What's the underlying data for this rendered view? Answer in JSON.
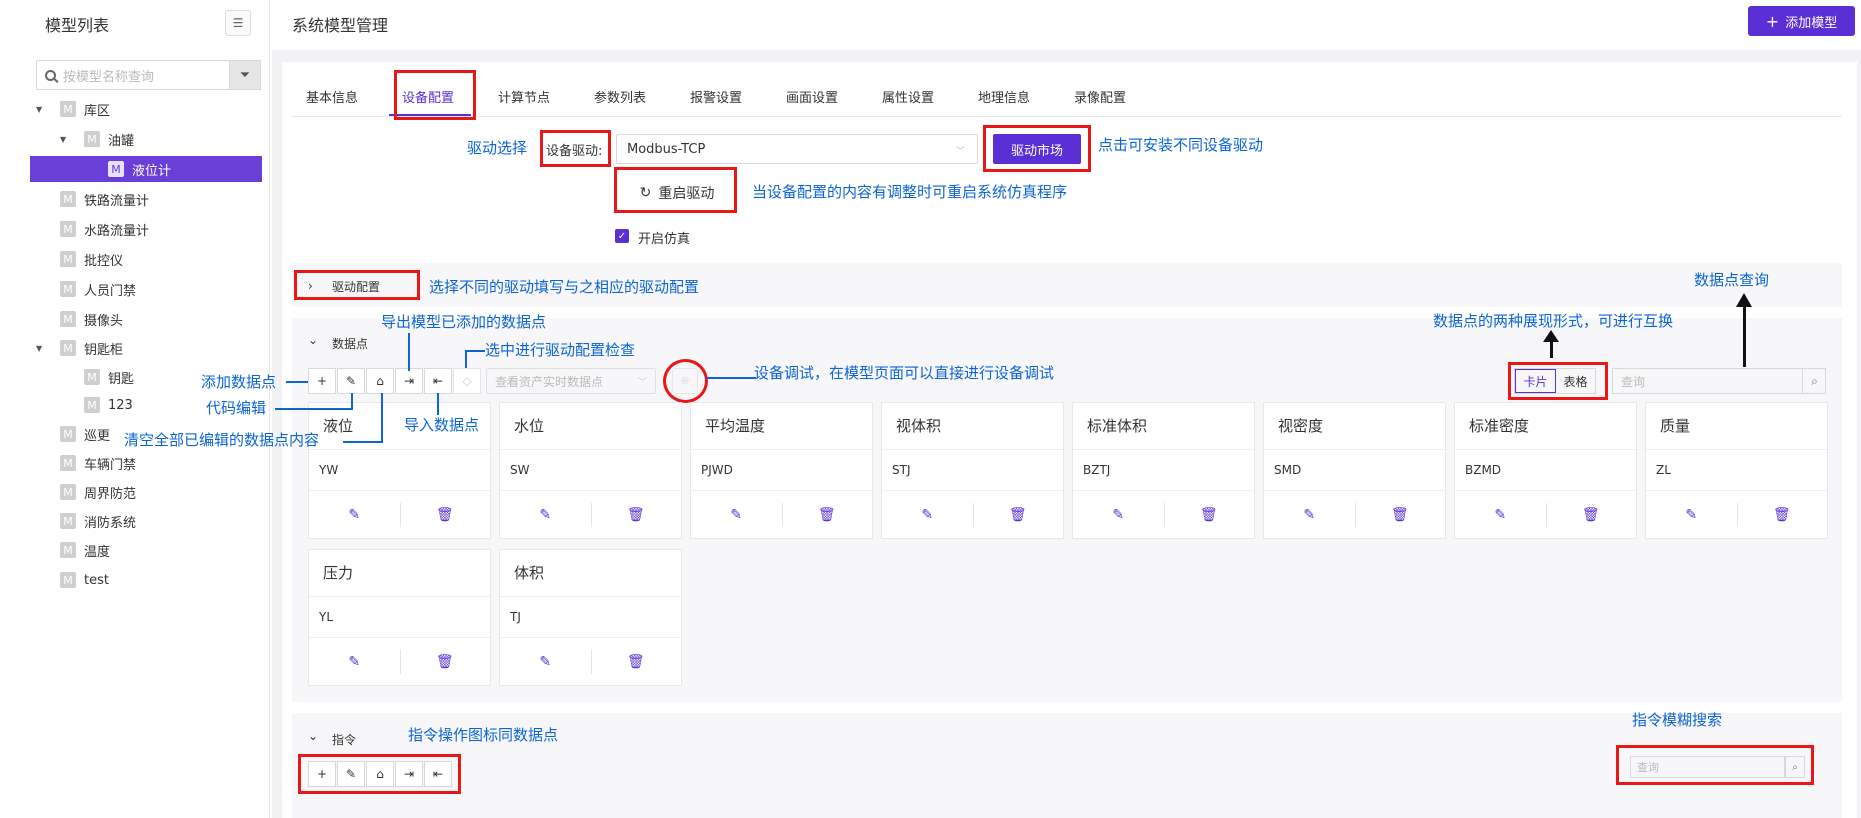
{
  "sidebar": {
    "title": "模型列表",
    "search_placeholder": "按模型名称查询",
    "tree": [
      {
        "label": "库区",
        "badge": "M",
        "level": 0,
        "expanded": true
      },
      {
        "label": "油罐",
        "badge": "M",
        "level": 1,
        "expanded": true
      },
      {
        "label": "液位计",
        "badge": "M",
        "level": 2,
        "selected": true
      },
      {
        "label": "铁路流量计",
        "badge": "M",
        "level": 0
      },
      {
        "label": "水路流量计",
        "badge": "M",
        "level": 0
      },
      {
        "label": "批控仪",
        "badge": "M",
        "level": 0
      },
      {
        "label": "人员门禁",
        "badge": "M",
        "level": 0
      },
      {
        "label": "摄像头",
        "badge": "M",
        "level": 0
      },
      {
        "label": "钥匙柜",
        "badge": "M",
        "level": 0,
        "expanded": true
      },
      {
        "label": "钥匙",
        "badge": "M",
        "level": 1
      },
      {
        "label": "123",
        "badge": "M",
        "level": 1
      },
      {
        "label": "巡更",
        "badge": "M",
        "level": 0
      },
      {
        "label": "车辆门禁",
        "badge": "M",
        "level": 0
      },
      {
        "label": "周界防范",
        "badge": "M",
        "level": 0
      },
      {
        "label": "消防系统",
        "badge": "M",
        "level": 0
      },
      {
        "label": "温度",
        "badge": "M",
        "level": 0
      },
      {
        "label": "test",
        "badge": "M",
        "level": 0
      }
    ]
  },
  "header": {
    "title": "系统模型管理",
    "add_button": "添加模型"
  },
  "tabs": [
    "基本信息",
    "设备配置",
    "计算节点",
    "参数列表",
    "报警设置",
    "画面设置",
    "属性设置",
    "地理信息",
    "录像配置"
  ],
  "active_tab": "设备配置",
  "driver": {
    "label": "设备驱动:",
    "value": "Modbus-TCP",
    "market_button": "驱动市场",
    "restart_button": "重启驱动",
    "simulation_label": "开启仿真",
    "simulation_checked": true
  },
  "sections": {
    "driver_config": "驱动配置",
    "datapoints": "数据点",
    "instructions": "指令"
  },
  "datapoints": {
    "asset_placeholder": "查看资产实时数据点",
    "view_card": "卡片",
    "view_table": "表格",
    "search_placeholder": "查询",
    "cards": [
      {
        "name": "液位",
        "code": "YW"
      },
      {
        "name": "水位",
        "code": "SW"
      },
      {
        "name": "平均温度",
        "code": "PJWD"
      },
      {
        "name": "视体积",
        "code": "STJ"
      },
      {
        "name": "标准体积",
        "code": "BZTJ"
      },
      {
        "name": "视密度",
        "code": "SMD"
      },
      {
        "name": "标准密度",
        "code": "BZMD"
      },
      {
        "name": "质量",
        "code": "ZL"
      },
      {
        "name": "压力",
        "code": "YL"
      },
      {
        "name": "体积",
        "code": "TJ"
      }
    ]
  },
  "instructions": {
    "search_placeholder": "查询"
  },
  "annotations": {
    "driver_select": "驱动选择",
    "market": "点击可安装不同设备驱动",
    "restart": "当设备配置的内容有调整时可重启系统仿真程序",
    "driver_config": "选择不同的驱动填写与之相应的驱动配置",
    "datapoint_query": "数据点查询",
    "view_modes": "数据点的两种展现形式，可进行互换",
    "export": "导出模型已添加的数据点",
    "check": "选中进行驱动配置检查",
    "add": "添加数据点",
    "code_edit": "代码编辑",
    "import": "导入数据点",
    "clear": "清空全部已编辑的数据点内容",
    "debug": "设备调试，在模型页面可以直接进行设备调试",
    "instr_ops": "指令操作图标同数据点",
    "instr_search": "指令模糊搜索"
  },
  "colors": {
    "accent": "#5b2fd6",
    "annotation": "#0c64d6",
    "highlight": "#e81818"
  }
}
